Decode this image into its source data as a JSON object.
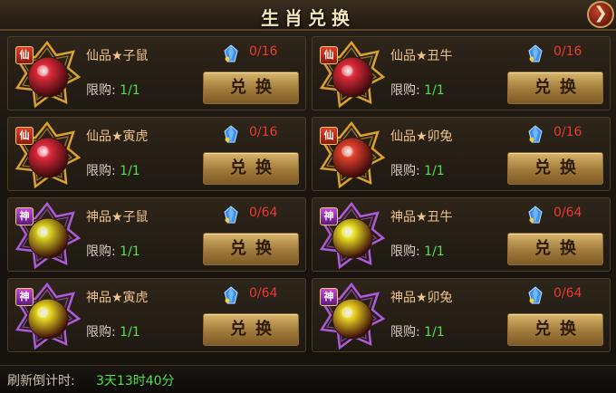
{
  "title": "生肖兑换",
  "close_icon": "close-arrow-icon",
  "items": [
    {
      "badge": "仙",
      "tier": "xian",
      "name": "仙品★子鼠",
      "cost": "0/16",
      "limit_label": "限购:",
      "limit_value": "1/1",
      "button": "兑换",
      "gem_color": "#e02a3a",
      "glow": "#f0b030",
      "emblem": "rat"
    },
    {
      "badge": "仙",
      "tier": "xian",
      "name": "仙品★丑牛",
      "cost": "0/16",
      "limit_label": "限购:",
      "limit_value": "1/1",
      "button": "兑换",
      "gem_color": "#e02a3a",
      "glow": "#f0b030",
      "emblem": "ox"
    },
    {
      "badge": "仙",
      "tier": "xian",
      "name": "仙品★寅虎",
      "cost": "0/16",
      "limit_label": "限购:",
      "limit_value": "1/1",
      "button": "兑换",
      "gem_color": "#e02a3a",
      "glow": "#f0b030",
      "emblem": "tiger"
    },
    {
      "badge": "仙",
      "tier": "xian",
      "name": "仙品★卯兔",
      "cost": "0/16",
      "limit_label": "限购:",
      "limit_value": "1/1",
      "button": "兑换",
      "gem_color": "#e0402a",
      "glow": "#f0b030",
      "emblem": "rabbit"
    },
    {
      "badge": "神",
      "tier": "shen",
      "name": "神品★子鼠",
      "cost": "0/64",
      "limit_label": "限购:",
      "limit_value": "1/1",
      "button": "兑换",
      "gem_color": "#d8d020",
      "glow": "#c060f0",
      "emblem": "rat"
    },
    {
      "badge": "神",
      "tier": "shen",
      "name": "神品★丑牛",
      "cost": "0/64",
      "limit_label": "限购:",
      "limit_value": "1/1",
      "button": "兑换",
      "gem_color": "#e8e020",
      "glow": "#c060f0",
      "emblem": "ox"
    },
    {
      "badge": "神",
      "tier": "shen",
      "name": "神品★寅虎",
      "cost": "0/64",
      "limit_label": "限购:",
      "limit_value": "1/1",
      "button": "兑换",
      "gem_color": "#e8d820",
      "glow": "#c060f0",
      "emblem": "tiger"
    },
    {
      "badge": "神",
      "tier": "shen",
      "name": "神品★卯兔",
      "cost": "0/64",
      "limit_label": "限购:",
      "limit_value": "1/1",
      "button": "兑换",
      "gem_color": "#e8d020",
      "glow": "#c060f0",
      "emblem": "rabbit"
    }
  ],
  "currency_icon": "blue-crystal-icon",
  "footer": {
    "label": "刷新倒计时:",
    "value": "3天13时40分"
  }
}
